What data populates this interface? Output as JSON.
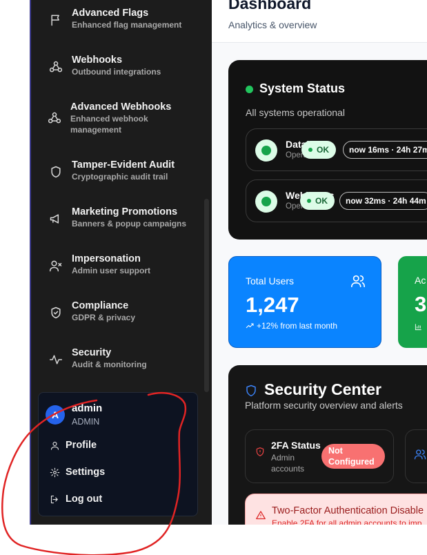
{
  "sidebar": {
    "items": [
      {
        "title": "Advanced Flags",
        "subtitle": "Enhanced flag management",
        "icon": "flag-icon"
      },
      {
        "title": "Webhooks",
        "subtitle": "Outbound integrations",
        "icon": "webhook-icon"
      },
      {
        "title": "Advanced Webhooks",
        "subtitle": "Enhanced webhook management",
        "icon": "webhook-icon"
      },
      {
        "title": "Tamper-Evident Audit",
        "subtitle": "Cryptographic audit trail",
        "icon": "shield-icon"
      },
      {
        "title": "Marketing Promotions",
        "subtitle": "Banners & popup campaigns",
        "icon": "megaphone-icon"
      },
      {
        "title": "Impersonation",
        "subtitle": "Admin user support",
        "icon": "user-x-icon"
      },
      {
        "title": "Compliance",
        "subtitle": "GDPR & privacy",
        "icon": "shield-check-icon"
      },
      {
        "title": "Security",
        "subtitle": "Audit & monitoring",
        "icon": "activity-icon"
      }
    ],
    "user": {
      "avatar_letter": "A",
      "name": "admin",
      "role": "ADMIN",
      "menu": [
        {
          "label": "Profile",
          "icon": "user-icon"
        },
        {
          "label": "Settings",
          "icon": "gear-icon"
        },
        {
          "label": "Log out",
          "icon": "logout-icon"
        }
      ]
    }
  },
  "header": {
    "title": "Dashboard",
    "subtitle": "Analytics & overview"
  },
  "system_status": {
    "title": "System Status",
    "subtitle": "All systems operational",
    "services": [
      {
        "name": "Datab",
        "state": "Operational",
        "badge": "OK",
        "timing": "now 16ms · 24h 27m"
      },
      {
        "name": "Webhooks",
        "state": "Operational",
        "badge": "OK",
        "timing": "now 32ms · 24h 44m"
      }
    ]
  },
  "stats": {
    "users_label": "Total Users",
    "users_value": "1,247",
    "users_trend": "+12% from last month",
    "active_label": "Ac",
    "active_value": "3"
  },
  "security_center": {
    "title": "Security Center",
    "subtitle": "Platform security overview and alerts",
    "twofa_title": "2FA Status",
    "twofa_sub": "Admin accounts",
    "twofa_badge": "Not Configured",
    "alert_title": "Two-Factor Authentication Disable",
    "alert_sub": "Enable 2FA for all admin accounts to imp"
  },
  "colors": {
    "sidebar_bg": "#1c1c1c",
    "accent_blue": "#0a84ff",
    "accent_green": "#16a34a",
    "danger": "#f87171",
    "annotation": "#e02424"
  }
}
